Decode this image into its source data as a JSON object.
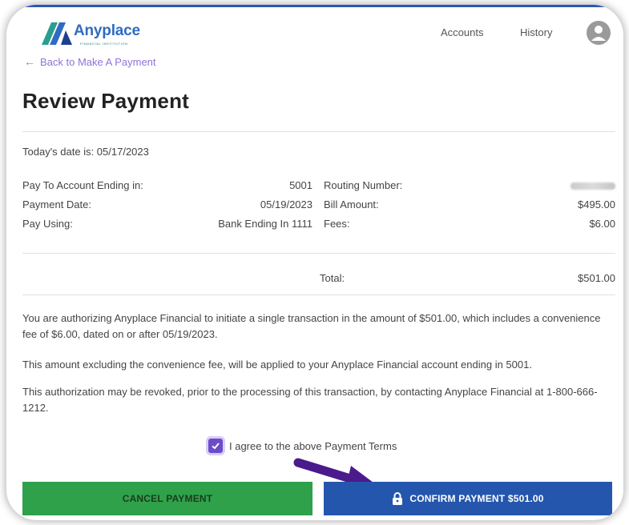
{
  "header": {
    "brand_name": "Anyplace",
    "brand_sub": "FINANCIAL INSTITUTION",
    "nav": [
      {
        "label": "Accounts"
      },
      {
        "label": "History"
      }
    ],
    "user_icon": "user-avatar-icon"
  },
  "back_link": {
    "label": "Back to Make A Payment",
    "icon": "arrow-left-icon"
  },
  "page": {
    "title": "Review Payment",
    "today": "Today's date is: 05/17/2023"
  },
  "details": {
    "pay_to_label": "Pay To Account Ending in:",
    "pay_to_value": "5001",
    "payment_date_label": "Payment Date:",
    "payment_date_value": "05/19/2023",
    "pay_using_label": "Pay Using:",
    "pay_using_value": "Bank Ending In 1111",
    "routing_label": "Routing Number:",
    "bill_label": "Bill Amount:",
    "bill_value": "$495.00",
    "fees_label": "Fees:",
    "fees_value": "$6.00",
    "total_label": "Total:",
    "total_value": "$501.00"
  },
  "terms": {
    "p1": "You are authorizing Anyplace Financial to initiate a single transaction in the amount of $501.00, which includes a convenience fee of $6.00, dated on or after 05/19/2023.",
    "p2": "This amount excluding the convenience fee, will be applied to your Anyplace Financial account ending in 5001.",
    "p3": "This authorization may be revoked, prior to the processing of this transaction, by contacting Anyplace Financial at 1-800-666-1212.",
    "agree_label": "I agree to the above Payment Terms",
    "agree_checked": true
  },
  "buttons": {
    "cancel_label": "CANCEL PAYMENT",
    "confirm_label": "CONFIRM PAYMENT $501.00"
  },
  "colors": {
    "brand_blue": "#2f6cc0",
    "accent_purple": "#8f73d9",
    "checkbox_purple": "#6c4ccc",
    "cancel_green": "#2fa14a",
    "confirm_blue": "#2456ad",
    "annotation_arrow": "#4b1a8c"
  }
}
